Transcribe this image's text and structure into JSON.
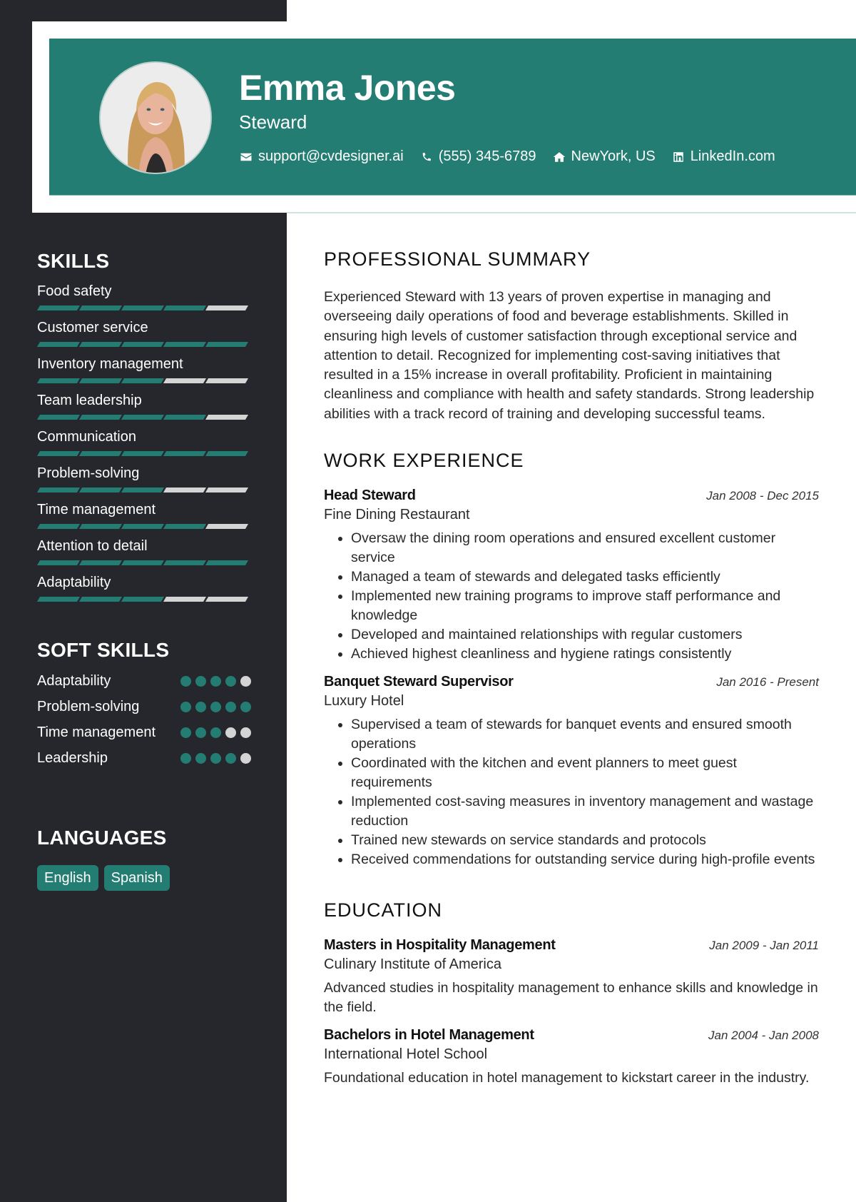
{
  "header": {
    "name": "Emma Jones",
    "title": "Steward",
    "contacts": [
      {
        "icon": "envelope-icon",
        "text": "support@cvdesigner.ai"
      },
      {
        "icon": "phone-icon",
        "text": "(555) 345-6789"
      },
      {
        "icon": "home-icon",
        "text": "NewYork, US"
      },
      {
        "icon": "linkedin-icon",
        "text": "LinkedIn.com"
      }
    ]
  },
  "colors": {
    "accent": "#247d72",
    "sidebar": "#26272c",
    "inactive": "#d4d4d4"
  },
  "sidebar": {
    "skills_heading": "SKILLS",
    "skills_max": 5,
    "skills": [
      {
        "name": "Food safety",
        "level": 4
      },
      {
        "name": "Customer service",
        "level": 5
      },
      {
        "name": "Inventory management",
        "level": 3
      },
      {
        "name": "Team leadership",
        "level": 4
      },
      {
        "name": "Communication",
        "level": 5
      },
      {
        "name": "Problem-solving",
        "level": 3
      },
      {
        "name": "Time management",
        "level": 4
      },
      {
        "name": "Attention to detail",
        "level": 5
      },
      {
        "name": "Adaptability",
        "level": 3
      }
    ],
    "soft_skills_heading": "SOFT SKILLS",
    "soft_skills_max": 5,
    "soft_skills": [
      {
        "name": "Adaptability",
        "level": 4
      },
      {
        "name": "Problem-solving",
        "level": 5
      },
      {
        "name": "Time management",
        "level": 3
      },
      {
        "name": "Leadership",
        "level": 4
      }
    ],
    "languages_heading": "LANGUAGES",
    "languages": [
      "English",
      "Spanish"
    ]
  },
  "main": {
    "summary_heading": "PROFESSIONAL SUMMARY",
    "summary": "Experienced Steward with 13 years of proven expertise in managing and overseeing daily operations of food and beverage establishments. Skilled in ensuring high levels of customer satisfaction through exceptional service and attention to detail. Recognized for implementing cost-saving initiatives that resulted in a 15% increase in overall profitability. Proficient in maintaining cleanliness and compliance with health and safety standards. Strong leadership abilities with a track record of training and developing successful teams.",
    "experience_heading": "WORK EXPERIENCE",
    "experience": [
      {
        "title": "Head Steward",
        "dates": "Jan 2008 - Dec 2015",
        "org": "Fine Dining Restaurant",
        "bullets": [
          "Oversaw the dining room operations and ensured excellent customer service",
          "Managed a team of stewards and delegated tasks efficiently",
          "Implemented new training programs to improve staff performance and knowledge",
          "Developed and maintained relationships with regular customers",
          "Achieved highest cleanliness and hygiene ratings consistently"
        ]
      },
      {
        "title": "Banquet Steward Supervisor",
        "dates": "Jan 2016 - Present",
        "org": "Luxury Hotel",
        "bullets": [
          "Supervised a team of stewards for banquet events and ensured smooth operations",
          "Coordinated with the kitchen and event planners to meet guest requirements",
          "Implemented cost-saving measures in inventory management and wastage reduction",
          "Trained new stewards on service standards and protocols",
          "Received commendations for outstanding service during high-profile events"
        ]
      }
    ],
    "education_heading": "EDUCATION",
    "education": [
      {
        "degree": "Masters in Hospitality Management",
        "dates": "Jan 2009 - Jan 2011",
        "school": "Culinary Institute of America",
        "description": "Advanced studies in hospitality management to enhance skills and knowledge in the field."
      },
      {
        "degree": "Bachelors in Hotel Management",
        "dates": "Jan 2004 - Jan 2008",
        "school": "International Hotel School",
        "description": "Foundational education in hotel management to kickstart career in the industry."
      }
    ]
  }
}
